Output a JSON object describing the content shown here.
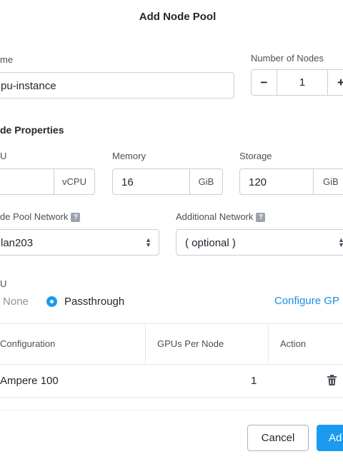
{
  "dialog": {
    "title": "Add Node Pool"
  },
  "name_field": {
    "label": "me",
    "value": "pu-instance"
  },
  "nodes": {
    "label": "Number of Nodes",
    "minus": "−",
    "value": "1",
    "plus": "+"
  },
  "node_properties": {
    "heading": "de Properties",
    "cpu": {
      "label": "U",
      "value": "",
      "unit": "vCPU"
    },
    "memory": {
      "label": "Memory",
      "value": "16",
      "unit": "GiB"
    },
    "storage": {
      "label": "Storage",
      "value": "120",
      "unit": "GiB"
    }
  },
  "network": {
    "label": "de Pool Network",
    "help": "?",
    "value": "lan203"
  },
  "additional_network": {
    "label": "Additional Network",
    "help": "?",
    "value": "( optional )"
  },
  "gpu": {
    "label": "U",
    "option_none": "None",
    "option_passthrough": "Passthrough",
    "selected": "Passthrough",
    "configure_link": "Configure GP"
  },
  "gpu_table": {
    "columns": [
      "Configuration",
      "GPUs Per Node",
      "Action"
    ],
    "rows": [
      {
        "configuration": "Ampere 100",
        "gpus_per_node": "1"
      }
    ]
  },
  "footer": {
    "cancel_label": "Cancel",
    "add_label": "Ad"
  },
  "colors": {
    "accent": "#1b9bf0",
    "link": "#1b8fe0"
  }
}
